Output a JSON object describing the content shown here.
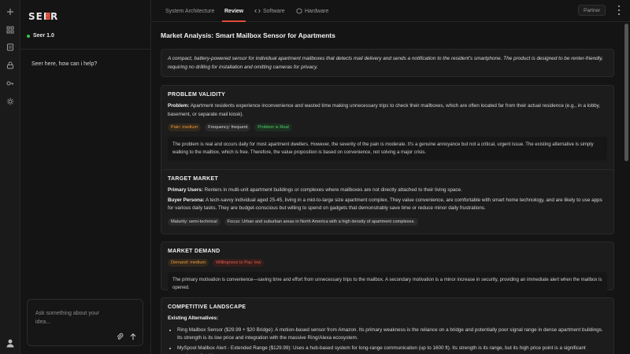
{
  "app": {
    "logo_text": "SEER",
    "model_name": "Seer 1.0"
  },
  "rail": {
    "icons": [
      "plus-icon",
      "grid-icon",
      "document-icon",
      "lock-icon",
      "key-icon",
      "sun-icon",
      "user-icon"
    ]
  },
  "chat": {
    "greeting": "Seer here, how can i help?",
    "input_placeholder": "Ask something about your idea..."
  },
  "tabs": [
    {
      "label": "System Architecture",
      "active": false
    },
    {
      "label": "Review",
      "active": true
    },
    {
      "label": "Software",
      "active": false,
      "icon": "code-icon"
    },
    {
      "label": "Hardware",
      "active": false,
      "icon": "chip-icon"
    }
  ],
  "topbar": {
    "partner_label": "Partner"
  },
  "page": {
    "title": "Market Analysis: Smart Mailbox Sensor for Apartments",
    "intro": "A compact, battery-powered sensor for individual apartment mailboxes that detects mail delivery and sends a notification to the resident's smartphone. The product is designed to be renter-friendly, requiring no drilling for installation and omitting cameras for privacy."
  },
  "problem": {
    "heading": "PROBLEM VALIDITY",
    "label": "Problem:",
    "text": "Apartment residents experience inconvenience and wasted time making unnecessary trips to check their mailboxes, which are often located far from their actual residence (e.g., in a lobby, basement, or separate mail kiosk).",
    "badges": [
      "Pain: medium",
      "Frequency: frequent",
      "Problem is Real"
    ],
    "summary": "The problem is real and occurs daily for most apartment dwellers. However, the severity of the pain is moderate. It's a genuine annoyance but not a critical, urgent issue. The existing alternative is simply walking to the mailbox, which is free. Therefore, the value proposition is based on convenience, not solving a major crisis."
  },
  "target": {
    "heading": "TARGET MARKET",
    "primary_label": "Primary Users:",
    "primary_text": "Renters in multi-unit apartment buildings or complexes where mailboxes are not directly attached to their living space.",
    "persona_label": "Buyer Persona:",
    "persona_text": "A tech-savvy individual aged 25-45, living in a mid-to-large size apartment complex. They value convenience, are comfortable with smart home technology, and are likely to use apps for various daily tasks. They are budget-conscious but willing to spend on gadgets that demonstrably save time or reduce minor daily frustrations.",
    "badges": [
      "Maturity: semi-technical",
      "Focus: Urban and suburban areas in North America with a high density of apartment complexes."
    ]
  },
  "demand": {
    "heading": "MARKET DEMAND",
    "badges": [
      "Demand: medium",
      "Willingness to Pay: low"
    ],
    "summary": "The primary motivation is convenience—saving time and effort from unnecessary trips to the mailbox. A secondary motivation is a minor increase in security, providing an immediate alert when the mailbox is opened."
  },
  "competition": {
    "heading": "COMPETITIVE LANDSCAPE",
    "sub_heading": "Existing Alternatives:",
    "items": [
      "Ring Mailbox Sensor ($29.99 + $20 Bridge): A motion-based sensor from Amazon. Its primary weakness is the reliance on a bridge and potentially poor signal range in dense apartment buildings. Its strength is its low price and integration with the massive Ring/Alexa ecosystem.",
      "MySpool Mailbox Alert - Extended Range ($129.99): Uses a hub-based system for long-range communication (up to 1600 ft). Its strength is its range, but its high price point is a significant weakness for this"
    ]
  },
  "colors": {
    "accent": "#e04a3a",
    "green": "#4fcf6a",
    "orange": "#e89a3c",
    "red": "#e55a4a"
  }
}
